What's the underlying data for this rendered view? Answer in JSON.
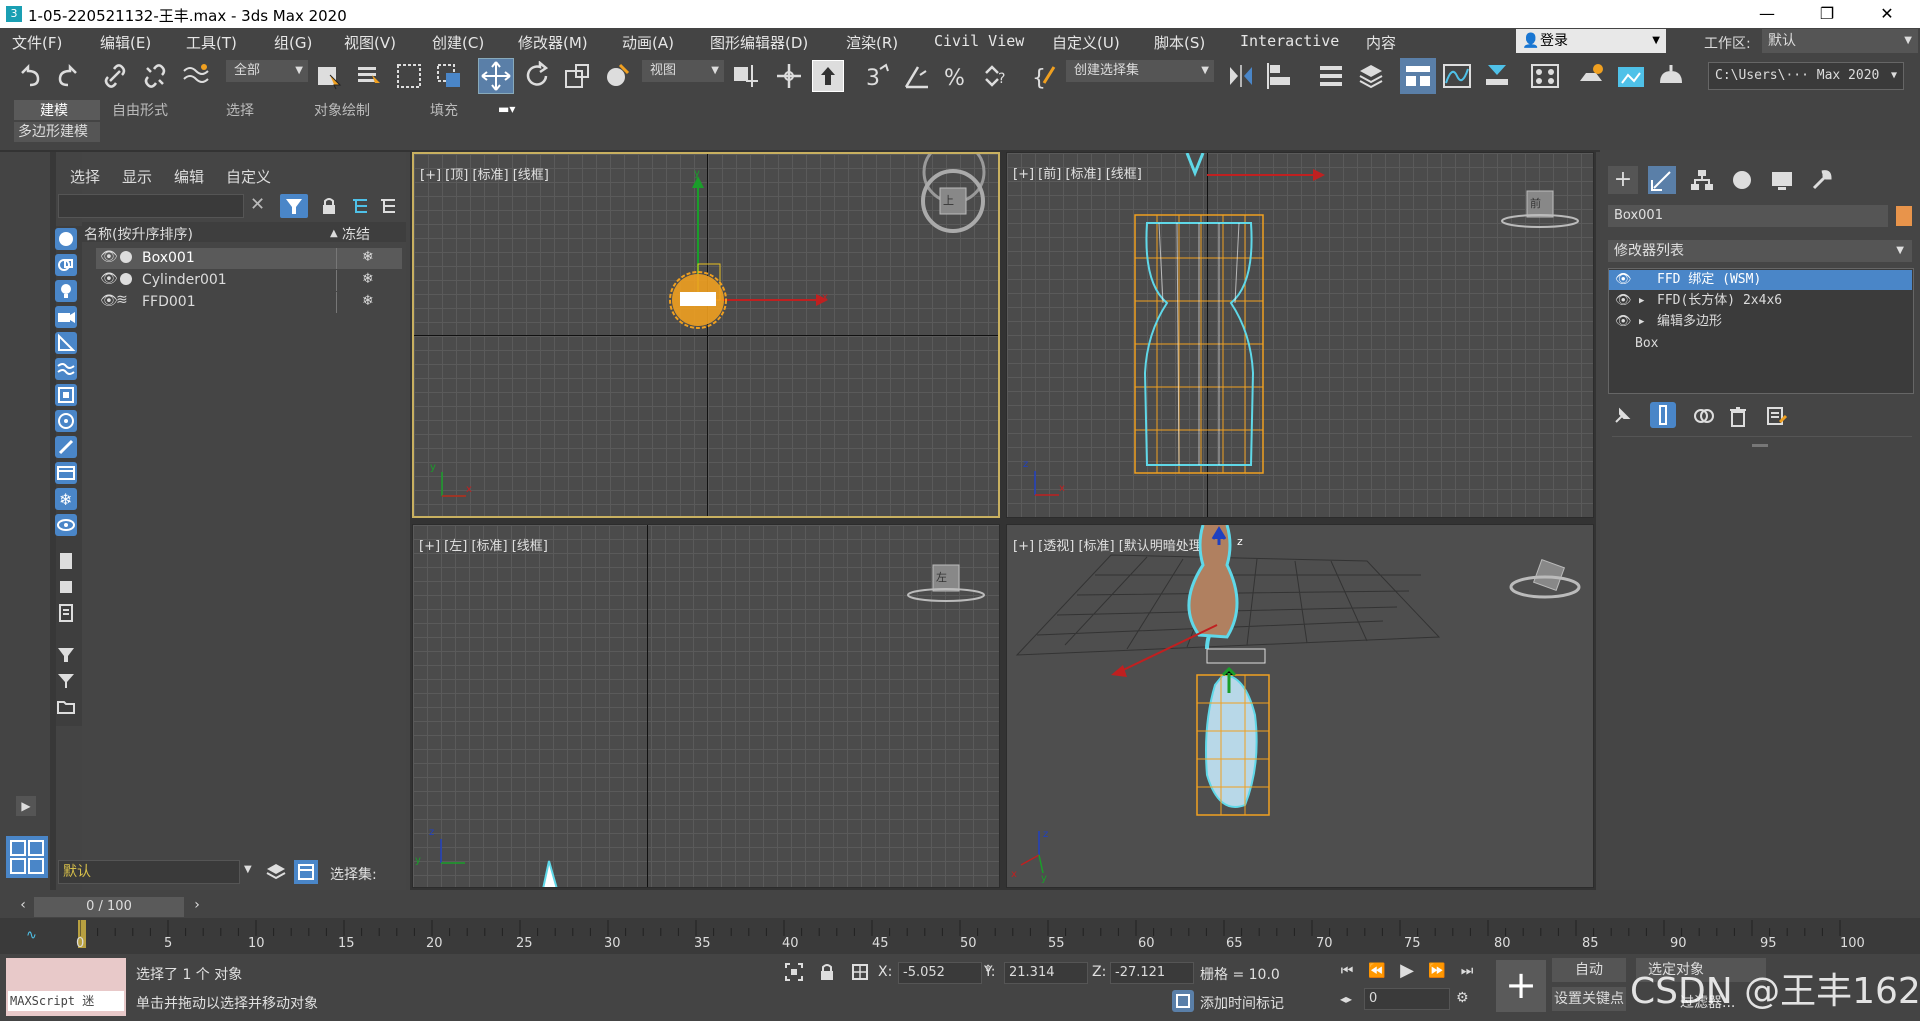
{
  "window": {
    "title": "1-05-220521132-王丰.max - 3ds Max 2020",
    "icon": "3ds-max-app-icon",
    "minimize_icon": "minimize-icon",
    "restore_icon": "restore-icon",
    "close_icon": "close-icon"
  },
  "menubar": {
    "items": [
      "文件(F)",
      "编辑(E)",
      "工具(T)",
      "组(G)",
      "视图(V)",
      "创建(C)",
      "修改器(M)",
      "动画(A)",
      "图形编辑器(D)",
      "渲染(R)",
      "Civil View",
      "自定义(U)",
      "脚本(S)",
      "Interactive",
      "内容"
    ],
    "login": "登录",
    "workspace_label": "工作区:",
    "workspace_value": "默认"
  },
  "toolbar": {
    "selection_filter": "全部",
    "ref_coord": "视图",
    "named_selection": "创建选择集",
    "project_path": "C:\\Users\\··· Max 2020"
  },
  "ribbon": {
    "tabs": [
      "建模",
      "自由形式",
      "选择",
      "对象绘制",
      "填充"
    ],
    "active_tab": "建模",
    "sub_panel": "多边形建模"
  },
  "scene_explorer": {
    "tabs": [
      "选择",
      "显示",
      "编辑",
      "自定义"
    ],
    "col_name": "名称(按升序排序)",
    "col_freeze": "冻结",
    "sort_arrow": "▲",
    "rows": [
      {
        "name": "Box001",
        "selected": true
      },
      {
        "name": "Cylinder001",
        "selected": false
      },
      {
        "name": "FFD001",
        "selected": false
      }
    ],
    "layer": "默认",
    "selection_set_label": "选择集:"
  },
  "viewports": {
    "top": "[+] [顶] [标准] [线框]",
    "front": "[+] [前] [标准] [线框]",
    "left": "[+] [左] [标准] [线框]",
    "perspective": "[+] [透视] [标准] [默认明暗处理]",
    "viewcube_top": "上",
    "viewcube_front": "前",
    "viewcube_left": "左",
    "axis_x": "x",
    "axis_y": "y",
    "axis_z": "z"
  },
  "command_panel": {
    "object_name": "Box001",
    "object_color": "#e8944b",
    "modifier_list": "修改器列表",
    "stack": [
      {
        "label": "FFD 绑定 (WSM)",
        "selected": true,
        "expandable": false
      },
      {
        "label": "FFD(长方体) 2x4x6",
        "selected": false,
        "expandable": true
      },
      {
        "label": "编辑多边形",
        "selected": false,
        "expandable": true
      },
      {
        "label": "Box",
        "selected": false,
        "expandable": false
      }
    ]
  },
  "timeline": {
    "slider": "0 / 100",
    "ticks": [
      "0",
      "5",
      "10",
      "15",
      "20",
      "25",
      "30",
      "35",
      "40",
      "45",
      "50",
      "55",
      "60",
      "65",
      "70",
      "75",
      "80",
      "85",
      "90",
      "95",
      "100"
    ]
  },
  "status": {
    "maxscript": "MAXScript 迷",
    "selected": "选择了 1 个 对象",
    "hint": "单击并拖动以选择并移动对象",
    "x_label": "X:",
    "x": "-5.052",
    "y_label": "Y:",
    "y": "21.314",
    "z_label": "Z:",
    "z": "-27.121",
    "grid": "栅格 = 10.0",
    "add_time_tag": "添加时间标记",
    "auto_key": "自动",
    "set_key": "设置关键点",
    "key_filter": "选定对象",
    "filters": "过滤器...",
    "frame": "0"
  },
  "watermark": "CSDN @王丰162",
  "colors": {
    "accent": "#4a86c8",
    "selection_orange": "#f0a020",
    "wire_cyan": "#5fd8e8"
  }
}
